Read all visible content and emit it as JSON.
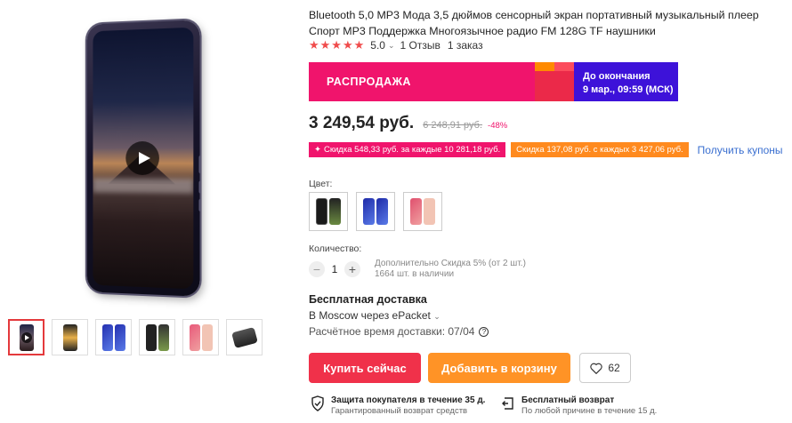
{
  "product": {
    "title": "Bluetooth 5,0 MP3 Мода 3,5 дюймов сенсорный экран портативный музыкальный плеер Спорт MP3 Поддержка Многоязычное радио FM 128G TF наушники",
    "rating_value": "5.0",
    "reviews": "1 Отзыв",
    "orders": "1 заказ",
    "stars": 5
  },
  "gallery": {
    "thumb_count": 6,
    "active_index": 0
  },
  "sale": {
    "label": "РАСПРОДАЖА",
    "ends_label": "До окончания",
    "ends_time": "9 мар., 09:59 (МСК)",
    "color_left": "#f0146c",
    "color_right": "#3d12d9"
  },
  "price": {
    "current": "3 249,54 руб.",
    "old": "6 248,91 руб.",
    "discount": "-48%"
  },
  "coupons": {
    "red": "Скидка 548,33 руб. за каждые 10 281,18 руб.",
    "orange": "Скидка 137,08 руб. с каждых 3 427,06 руб.",
    "get": "Получить купоны"
  },
  "options": {
    "color_label": "Цвет:",
    "quantity_label": "Количество:",
    "quantity": "1",
    "qty_note_1": "Дополнительно Скидка 5% (от 2 шт.)",
    "qty_note_2": "1664 шт. в наличии"
  },
  "shipping": {
    "title": "Бесплатная доставка",
    "destination": "В Moscow через ePacket",
    "estimate": "Расчётное время доставки: 07/04"
  },
  "actions": {
    "buy": "Купить сейчас",
    "cart": "Добавить в корзину",
    "wishlist_count": "62"
  },
  "guarantees": {
    "protection_title": "Защита покупателя в течение 35 д.",
    "protection_sub": "Гарантированный возврат средств",
    "return_title": "Бесплатный возврат",
    "return_sub": "По любой причине в течение 15 д."
  }
}
